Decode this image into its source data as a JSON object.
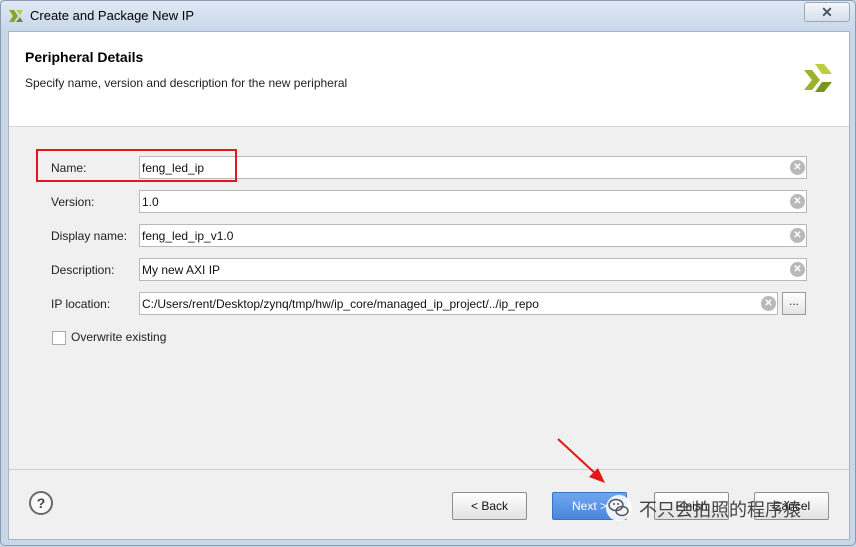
{
  "window": {
    "title": "Create and Package New IP",
    "close_glyph": "✕"
  },
  "header": {
    "title": "Peripheral Details",
    "subtitle": "Specify name, version and description for the new peripheral",
    "logo_icon": "xilinx-logo-icon"
  },
  "form": {
    "name": {
      "label": "Name:",
      "value": "feng_led_ip"
    },
    "version": {
      "label": "Version:",
      "value": "1.0"
    },
    "display_name": {
      "label": "Display name:",
      "value": "feng_led_ip_v1.0"
    },
    "description": {
      "label": "Description:",
      "value": "My new AXI IP"
    },
    "ip_location": {
      "label": "IP location:",
      "value": "C:/Users/rent/Desktop/zynq/tmp/hw/ip_core/managed_ip_project/../ip_repo",
      "browse_label": "..."
    },
    "overwrite": {
      "label": "Overwrite existing",
      "checked": false
    },
    "clear_glyph": "✕"
  },
  "footer": {
    "help_label": "?",
    "back_label": "< Back",
    "next_label": "Next >",
    "finish_label": "Finish",
    "cancel_label": "Cancel"
  },
  "watermark": {
    "text": "不只会拍照的程序猿"
  },
  "colors": {
    "highlight": "#e01818",
    "next_button": "#4a86dd",
    "arrow": "#e01818"
  }
}
